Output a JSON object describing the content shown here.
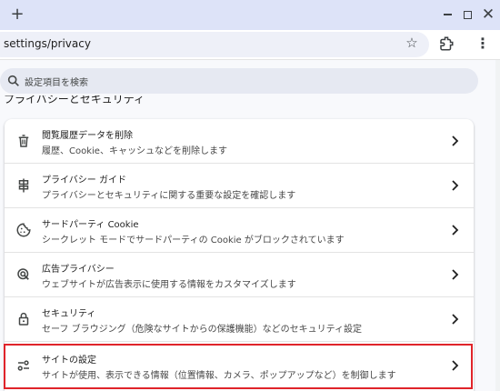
{
  "browser": {
    "new_tab_symbol": "+",
    "url": "settings/privacy",
    "icons": [
      "plus-icon",
      "minimize-icon",
      "maximize-icon",
      "close-icon",
      "star-icon",
      "extensions-icon",
      "more-menu-icon"
    ]
  },
  "search": {
    "placeholder": "設定項目を検索"
  },
  "section": {
    "title": "プライバシーとセキュリティ"
  },
  "items": [
    {
      "title": "閲覧履歴データを削除",
      "subtitle": "履歴、Cookie、キャッシュなどを削除します",
      "icon": "trash-icon"
    },
    {
      "title": "プライバシー ガイド",
      "subtitle": "プライバシーとセキュリティに関する重要な設定を確認します",
      "icon": "privacy-guide-icon"
    },
    {
      "title": "サードパーティ Cookie",
      "subtitle": "シークレット モードでサードパーティの Cookie がブロックされています",
      "icon": "cookie-icon"
    },
    {
      "title": "広告プライバシー",
      "subtitle": "ウェブサイトが広告表示に使用する情報をカスタマイズします",
      "icon": "ad-privacy-icon"
    },
    {
      "title": "セキュリティ",
      "subtitle": "セーフ ブラウジング（危険なサイトからの保護機能）などのセキュリティ設定",
      "icon": "lock-icon"
    },
    {
      "title": "サイトの設定",
      "subtitle": "サイトが使用、表示できる情報（位置情報、カメラ、ポップアップなど）を制御します",
      "icon": "site-settings-icon"
    }
  ],
  "colors": {
    "highlight": "#e0242a",
    "titlebar": "#dde3f8"
  }
}
